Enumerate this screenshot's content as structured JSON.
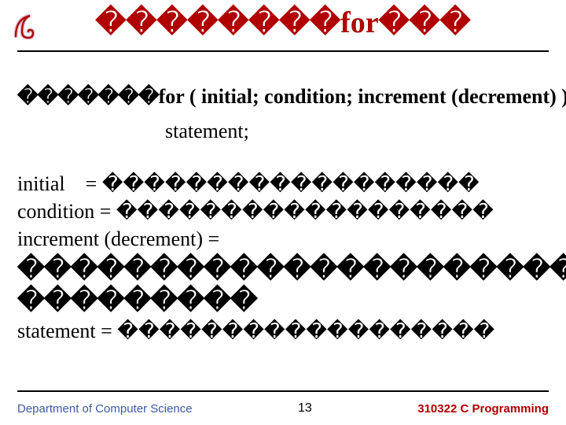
{
  "title": {
    "boxes_left": "��������",
    "word": "for",
    "boxes_right": "���"
  },
  "syntax": {
    "boxes": "�������",
    "text": "for ( initial; condition; increment (decrement) )",
    "statement": "statement;"
  },
  "defs": {
    "initial_label": "initial",
    "initial_eq": "= ������������������",
    "condition_label": "condition",
    "condition_eq": "= ������������������",
    "increment_label": "increment (decrement) =",
    "big_boxes_line1": "���������������������",
    "big_boxes_line2": "���������",
    "statement_label": "statement",
    "statement_eq": "= ������������������"
  },
  "footer": {
    "dept": "Department of Computer Science",
    "page": "13",
    "course": "310322 C Programming"
  }
}
